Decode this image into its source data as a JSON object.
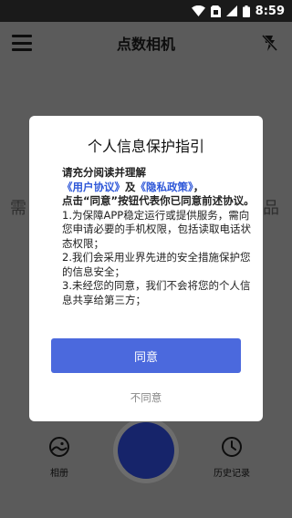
{
  "status_bar": {
    "time": "8:59",
    "icons": [
      "wifi-icon",
      "sim-card-icon",
      "signal-icon",
      "battery-icon"
    ]
  },
  "app_bar": {
    "title": "点数相机",
    "left_icon": "menu-icon",
    "right_icon": "flash-off-icon"
  },
  "background": {
    "left_text": "需",
    "right_text": "品"
  },
  "bottom_bar": {
    "album_label": "相册",
    "history_label": "历史记录"
  },
  "dialog": {
    "title": "个人信息保护指引",
    "intro": "请充分阅读并理解",
    "user_agreement": "《用户协议》",
    "and": "及",
    "privacy_policy": "《隐私政策》",
    "comma": "，",
    "click_notice": "点击“同意”按钮代表你已同意前述协议。",
    "item1": "1.为保障APP稳定运行或提供服务，需向您申请必要的手机权限，包括读取电话状态权限；",
    "item2": "2.我们会采用业界先进的安全措施保护您的信息安全；",
    "item3": "3.未经您的同意，我们不会将您的个人信息共享给第三方；",
    "agree_label": "同意",
    "disagree_label": "不同意"
  },
  "colors": {
    "overlay_gray": "#5b5b5b",
    "status_bar_bg": "#1a1a1a",
    "agree_button": "#4b69dd",
    "link_blue": "#2e57d8",
    "shutter_inner": "#16246a"
  }
}
